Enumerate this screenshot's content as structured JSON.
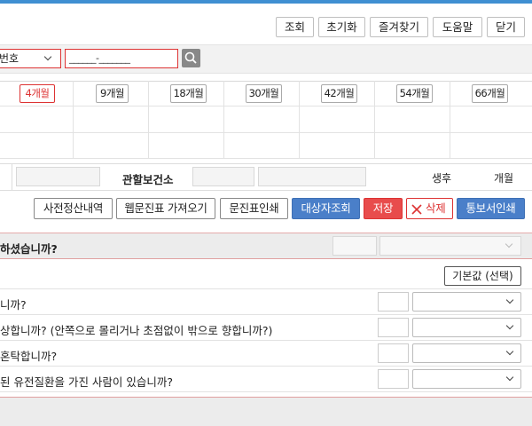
{
  "toolbar": {
    "query_label": "조회",
    "reset_label": "초기화",
    "favorites_label": "즐겨찾기",
    "help_label": "도움말",
    "close_label": "닫기"
  },
  "search": {
    "type_selected": "번호",
    "number_value": "______-_______"
  },
  "grid": {
    "months": [
      "4개월",
      "9개월",
      "18개월",
      "30개월",
      "42개월",
      "54개월",
      "66개월"
    ]
  },
  "info": {
    "health_center_label": "관할보건소",
    "birth_label": "생후",
    "month_unit": "개월"
  },
  "actions": {
    "prepay_history": "사전정산내역",
    "web_questionnaire": "웹문진표 가져오기",
    "print_questionnaire": "문진표인쇄",
    "target_query": "대상자조회",
    "save": "저장",
    "delete": "삭제",
    "print_notice": "통보서인쇄"
  },
  "questions": {
    "header": "하셨습니까?",
    "default_button": "기본값 (선택)",
    "items": [
      "니까?",
      "상합니까? (안쪽으로 몰리거나 초점없이 밖으로 향합니까?)",
      " 혼탁합니까?",
      "된 유전질환을 가진 사람이 있습니까?"
    ]
  },
  "colors": {
    "accent_blue": "#4a7fc9",
    "danger_red": "#e84c4c",
    "highlight_red": "#d33333",
    "top_bar": "#3f8fd2"
  }
}
